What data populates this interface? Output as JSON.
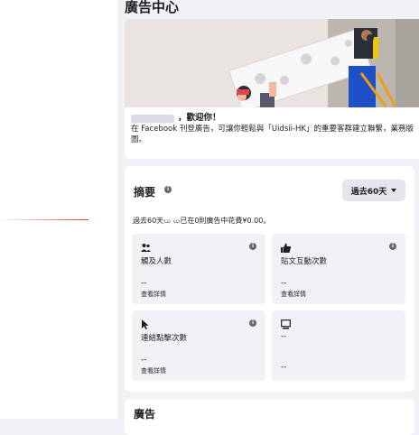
{
  "page": {
    "title": "廣告中心"
  },
  "hero": {
    "welcome": "，歡迎你！",
    "description": "在 Facebook 刊登廣告，可讓你輕鬆與「Uidsii-HK」的重要客群建立聯繫，業務版圖。"
  },
  "summary": {
    "title": "摘要",
    "date_range": "過去60天",
    "description": "過去60天ဃ ဃ已在0則廣告中花費¥0.00。",
    "metrics": [
      {
        "icon": "people-icon",
        "label": "觸及人數",
        "value": "--",
        "link": "查看詳情"
      },
      {
        "icon": "thumbs-up-icon",
        "label": "貼文互動次數",
        "value": "--",
        "link": "查看詳情"
      },
      {
        "icon": "cursor-icon",
        "label": "連結點擊次數",
        "value": "--",
        "link": "查看詳情"
      },
      {
        "icon": "monitor-icon",
        "label": "--",
        "value": "--",
        "link": ""
      }
    ]
  },
  "ads": {
    "title": "廣告"
  },
  "colors": {
    "accent_bg": "#e4e6eb",
    "metric_bg": "#f0f2f5",
    "page_bg": "#f0f2f5"
  }
}
